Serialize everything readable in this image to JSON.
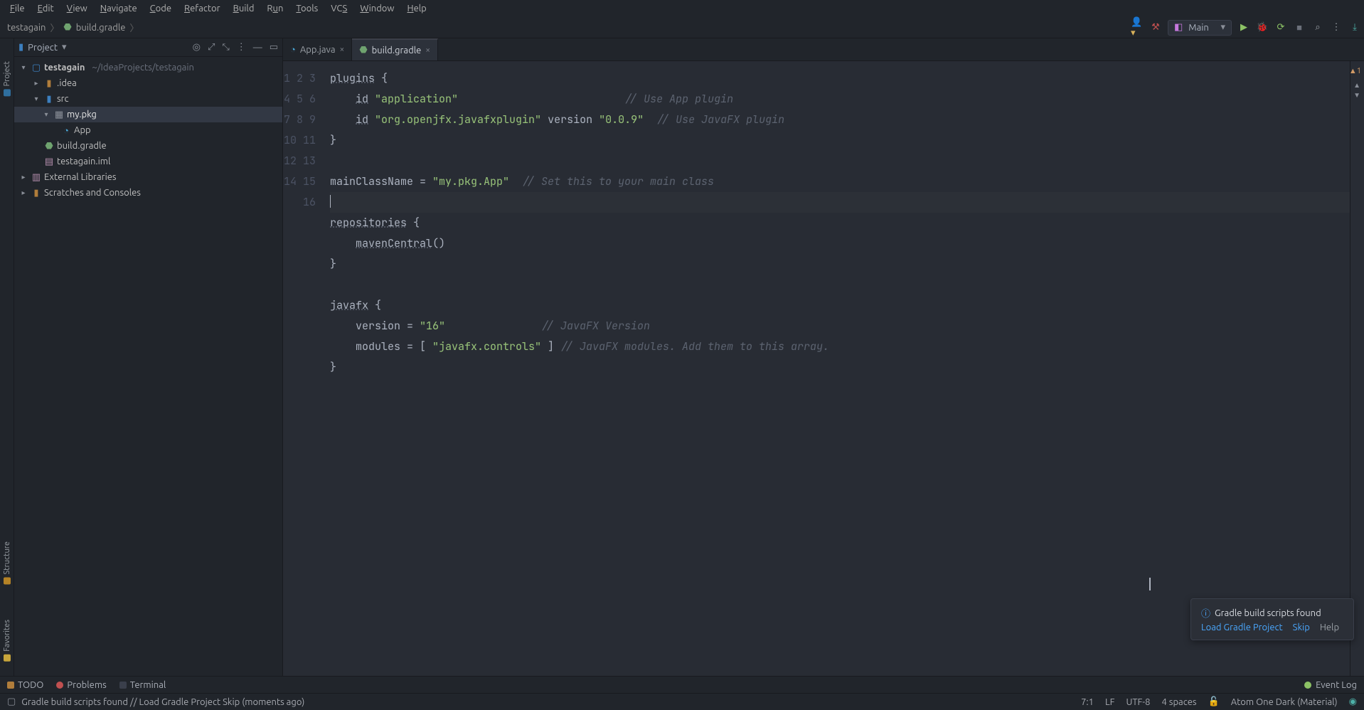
{
  "menu": [
    "File",
    "Edit",
    "View",
    "Navigate",
    "Code",
    "Refactor",
    "Build",
    "Run",
    "Tools",
    "VCS",
    "Window",
    "Help"
  ],
  "breadcrumb": {
    "project": "testagain",
    "file": "build.gradle"
  },
  "run_config": {
    "name": "Main"
  },
  "project_panel": {
    "title": "Project",
    "root": {
      "name": "testagain",
      "path": "~/IdeaProjects/testagain"
    },
    "idea_folder": ".idea",
    "src_folder": "src",
    "pkg": "my.pkg",
    "app_class": "App",
    "build_file": "build.gradle",
    "iml_file": "testagain.iml",
    "ext_libs": "External Libraries",
    "scratches": "Scratches and Consoles"
  },
  "tabs": [
    {
      "label": "App.java",
      "active": false
    },
    {
      "label": "build.gradle",
      "active": true
    }
  ],
  "code_lines": [
    "plugins {",
    "    id \"application\"                          // Use App plugin",
    "    id \"org.openjfx.javafxplugin\" version \"0.0.9\"  // Use JavaFX plugin",
    "}",
    "",
    "mainClassName = \"my.pkg.App\"  // Set this to your main class",
    "",
    "repositories {",
    "    mavenCentral()",
    "}",
    "",
    "javafx {",
    "    version = \"16\"               // JavaFX Version",
    "    modules = [ \"javafx.controls\" ] // JavaFX modules. Add them to this array.",
    "}",
    ""
  ],
  "inspection": {
    "warnings": 1
  },
  "notification": {
    "title": "Gradle build scripts found",
    "actions": [
      "Load Gradle Project",
      "Skip",
      "Help"
    ]
  },
  "bottom_tools": {
    "todo": "TODO",
    "problems": "Problems",
    "terminal": "Terminal",
    "eventlog": "Event Log"
  },
  "status": {
    "message": "Gradle build scripts found // Load Gradle Project   Skip (moments ago)",
    "caret": "7:1",
    "line_sep": "LF",
    "encoding": "UTF-8",
    "indent": "4 spaces",
    "theme": "Atom One Dark (Material)"
  },
  "left_gutter": {
    "project": "Project",
    "structure": "Structure",
    "favorites": "Favorites"
  }
}
